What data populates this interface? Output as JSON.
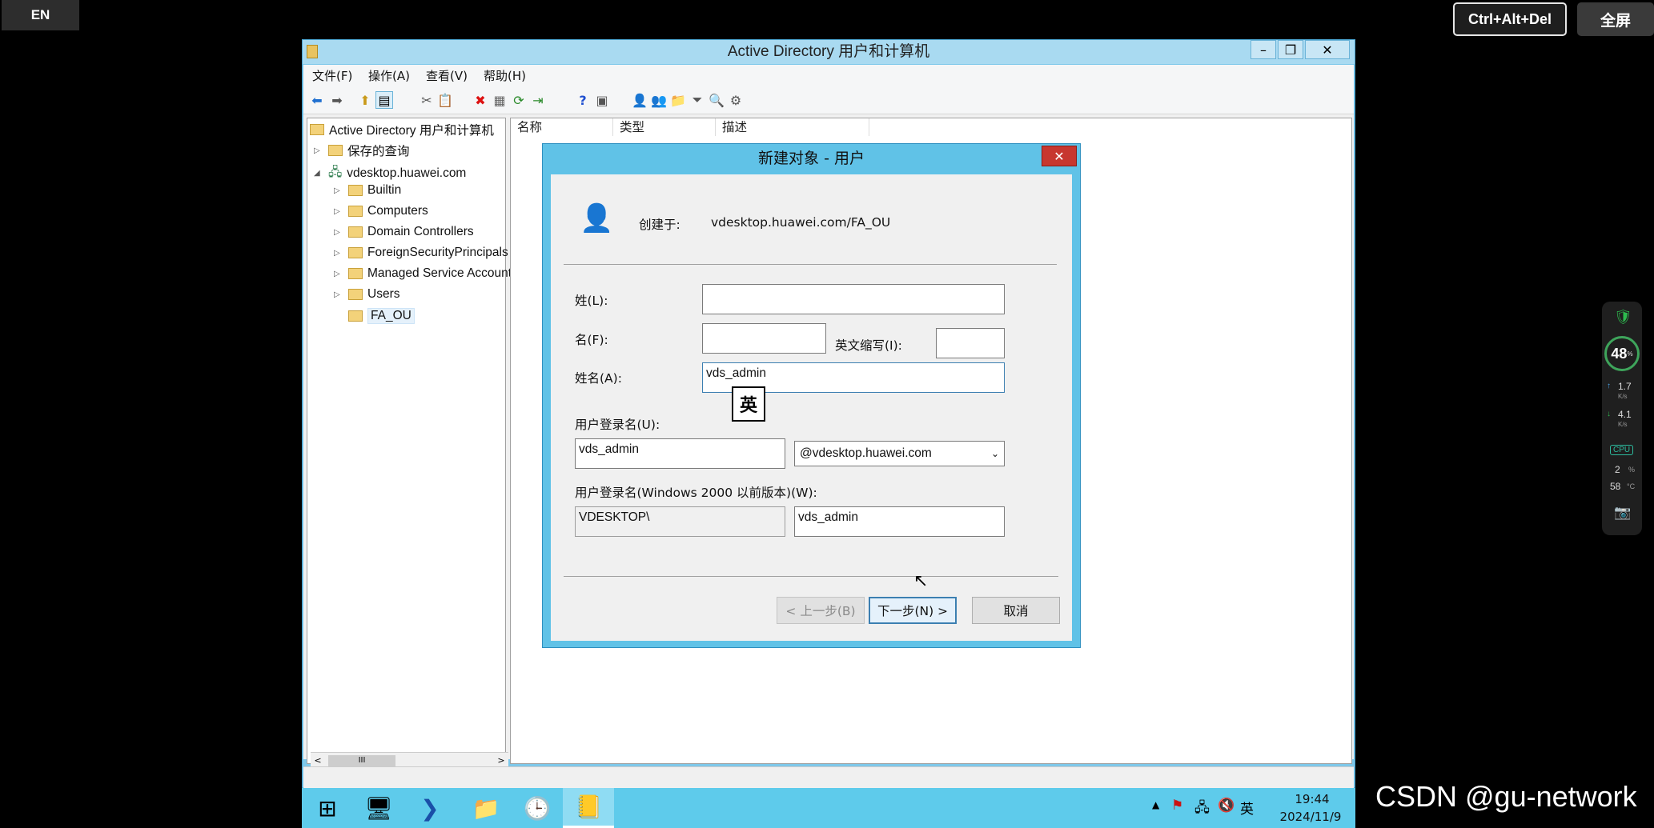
{
  "overlay": {
    "lang": "EN",
    "ctrl_alt_del": "Ctrl+Alt+Del",
    "fullscreen": "全屏"
  },
  "window": {
    "title": "Active Directory 用户和计算机",
    "controls": {
      "min": "–",
      "max": "❐",
      "close": "✕"
    },
    "menu": [
      "文件(F)",
      "操作(A)",
      "查看(V)",
      "帮助(H)"
    ],
    "toolbar_icons": [
      "back-icon",
      "forward-icon",
      "up-icon",
      "show-console-tree-icon",
      "cut-icon",
      "copy-icon",
      "delete-icon",
      "properties-icon",
      "refresh-icon",
      "export-icon",
      "help-icon",
      "view-icon",
      "new-user-icon",
      "new-group-icon",
      "new-ou-icon",
      "filter-icon",
      "find-icon",
      "add-to-group-icon"
    ]
  },
  "tree": {
    "root": "Active Directory 用户和计算机",
    "saved_queries": "保存的查询",
    "domain": "vdesktop.huawei.com",
    "children": [
      "Builtin",
      "Computers",
      "Domain Controllers",
      "ForeignSecurityPrincipals",
      "Managed Service Accounts",
      "Users",
      "FA_OU"
    ],
    "scroll_thumb": "III"
  },
  "list": {
    "columns": [
      "名称",
      "类型",
      "描述"
    ]
  },
  "dialog": {
    "title": "新建对象 - 用户",
    "created_in_label": "创建于:",
    "created_in_value": "vdesktop.huawei.com/FA_OU",
    "surname_label": "姓(L):",
    "surname_value": "",
    "given_label": "名(F):",
    "given_value": "",
    "initials_label": "英文缩写(I):",
    "initials_value": "",
    "fullname_label": "姓名(A):",
    "fullname_value": "vds_admin",
    "ime_indicator": "英",
    "logon_label": "用户登录名(U):",
    "logon_value": "vds_admin",
    "domain_suffix": "@vdesktop.huawei.com",
    "pre2000_label": "用户登录名(Windows 2000 以前版本)(W):",
    "pre2000_domain": "VDESKTOP\\",
    "pre2000_user": "vds_admin",
    "back_button": "< 上一步(B)",
    "next_button": "下一步(N) >",
    "cancel_button": "取消"
  },
  "taskbar": {
    "time": "19:44",
    "date": "2024/11/9",
    "ime": "英"
  },
  "widget": {
    "battery": "48",
    "unit_pct": "%",
    "up_speed": "1.7",
    "down_speed": "4.1",
    "speed_unit": "K/s",
    "cpu_label": "CPU",
    "cpu_pct": "2",
    "cpu_temp": "58",
    "temp_unit": "°C"
  },
  "watermark": "CSDN @gu-network"
}
